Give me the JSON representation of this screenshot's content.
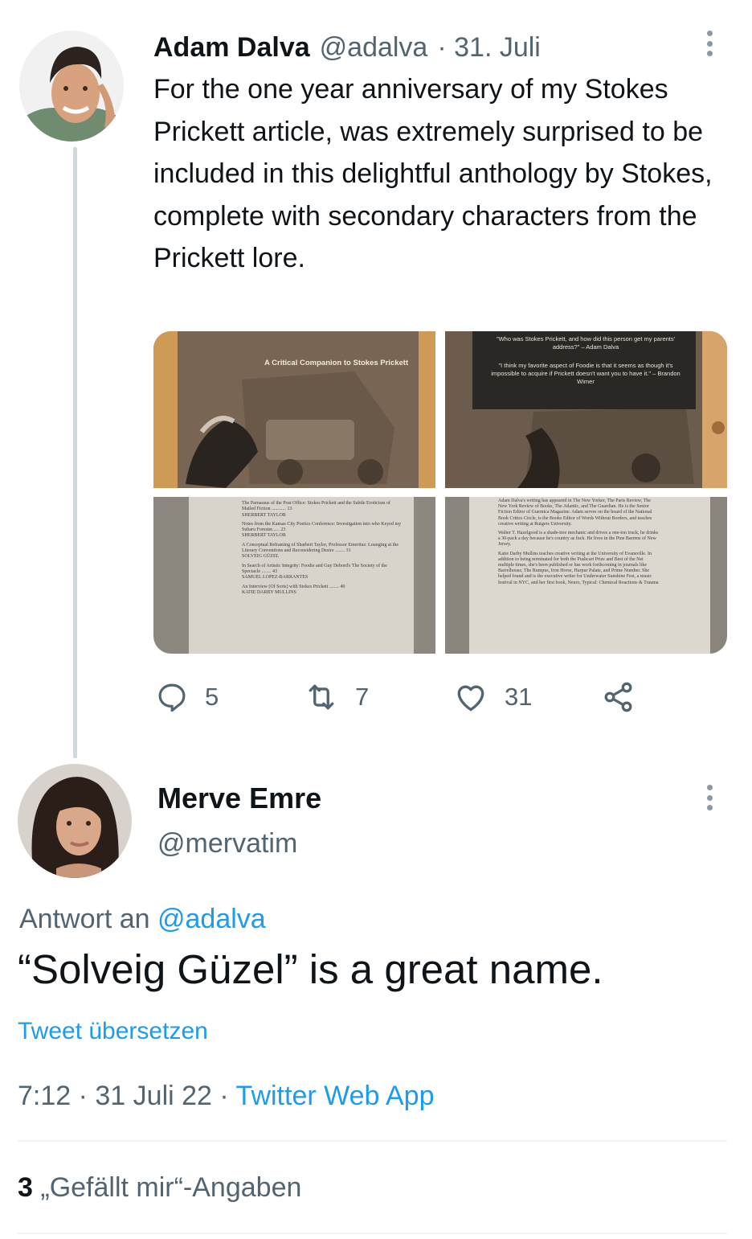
{
  "tweet": {
    "author_name": "Adam Dalva",
    "author_handle": "@adalva",
    "date": "· 31. Juli",
    "text": "For the one year anniversary of my Stokes Prickett article, was extremely surprised to be included in this delightful anthology by Stokes, complete with secondary characters from the Prickett lore.",
    "media": {
      "cover_title": "A Critical Companion to Stokes Prickett",
      "back_quote_1": "\"Who was Stokes Prickett, and how did this person get my parents' address?\" – Adam Dalva",
      "back_quote_2": "\"I think my favorite aspect of Foodie is that it seems as though it's impossible to acquire if Prickett doesn't want you to have it.\" – Brandon Wimer",
      "toc": [
        {
          "title": "The Parnassus of the Post Office: Stokes Prickett and the Subtle Eroticism of Mailed Fiction ............ 13",
          "author": "SHERBERT TAYLOR"
        },
        {
          "title": "Notes from the Kansas City Poetics Conference: Investigation into who Keyed my Subaru Forester...... 23",
          "author": "SHERBERT TAYLOR"
        },
        {
          "title": "A Conceptual Reframing of Sharbert Taylor, Professor Emeritus: Lounging at the Literary Conventions and Reconsidering Desire ........ 31",
          "author": "SOLVEIG GÜZEL"
        },
        {
          "title": "In Search of Artistic Integrity: Foodie and Guy Debord's The Society of the Spectacle ........ 43",
          "author": "SAMUEL LOPEZ-BARRANTES"
        },
        {
          "title": "An Interview (Of Sorts) with Stokes Prickett ........ 49",
          "author": "KATIE DARBY MULLINS"
        }
      ],
      "bios": [
        "Adam Dalva's writing has appeared in The New Yorker, The Paris Review, The New York Review of Books, The Atlantic, and The Guardian. He is the Senior Fiction Editor of Guernica Magazine. Adam serves on the board of the National Book Critics Circle, is the Books Editor of Words Without Borders, and teaches creative writing at Rutgers University.",
        "Walter T. Hazelgood is a shade-tree mechanic and drives a one-ton truck; he drinks a 30-pack a day because he's country as fuck. He lives in the Pine Barrens of New Jersey.",
        "Katie Darby Mullins teaches creative writing at the University of Evansville. In addition to being nominated for both the Pushcart Prize and Best of the Net multiple times, she's been published or has work forthcoming in journals like Barrelhouse, The Rumpus, Iron Horse, Harpur Palate, and Prime Number. She helped found and is the executive writer for Underwater Sunshine Fest, a music festival in NYC, and her first book, Neuro, Typical: Chemical Reactions & Trauma"
      ]
    },
    "actions": {
      "replies": "5",
      "retweets": "7",
      "likes": "31"
    }
  },
  "reply": {
    "author_name": "Merve Emre",
    "author_handle": "@mervatim",
    "replying_to_prefix": "Antwort an",
    "replying_to_handle": "@adalva",
    "text": "“Solveig Güzel” is a great name.",
    "translate": "Tweet übersetzen",
    "time": "7:12 · 31 Juli 22 ·",
    "source": "Twitter Web App",
    "likes_count": "3",
    "likes_label": "„Gefällt mir“-Angaben"
  },
  "colors": {
    "accent": "#1d9bf0",
    "muted": "#536471",
    "text": "#0f1419",
    "line": "#cfd9de"
  }
}
